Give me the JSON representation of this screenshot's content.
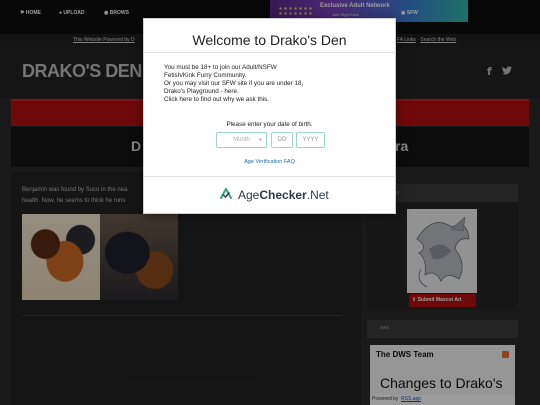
{
  "ad": {
    "title": "Exclusive Adult Network",
    "subtitle": "Join Right Now"
  },
  "powered_bar": {
    "left_text": "This Website Powered by D",
    "right_prefix": "FA Links",
    "right_sep": " · ",
    "right_link": "Search the Web"
  },
  "header": {
    "site_logo": "DRAKO'S DEN",
    "social_facebook_icon": "facebook-icon",
    "social_twitter_icon": "twitter-icon"
  },
  "nav": {
    "home": "HOME",
    "upload": "UPLOAD",
    "browse": "BROWS",
    "sfw": "SFW"
  },
  "page_title": {
    "left": "D",
    "right": "ra"
  },
  "content": {
    "story_line1": "Benjamin was found by Suco in the nea",
    "story_line2": "health. Now, he seems to think he runs"
  },
  "sidebar": {
    "mascot_panel_heading": "o",
    "submit_button": "Submit Mascot Art",
    "news_panel_heading": "ews",
    "news_card_title": "The DWS Team",
    "news_item": "Changes to Drako's",
    "powered_by": "Powered by",
    "rss_link": "RSS.app"
  },
  "modal": {
    "title": "Welcome to Drako's Den",
    "lines": [
      "You must be 18+ to join our Adult/NSFW",
      "Fetish/Kink Furry Community.",
      "Or you may visit our SFW site if you are under 18,",
      "Drako's Playground - here.",
      "Click here to find out why we ask this."
    ],
    "dob_prompt": "Please enter your date of birth.",
    "month_placeholder": "Month",
    "day_placeholder": "DD",
    "year_placeholder": "YYYY",
    "faq_link": "Age Verification FAQ",
    "brand_plain": "Age",
    "brand_bold": "Checker",
    "brand_suffix": ".Net"
  },
  "colors": {
    "nav_red": "#b40f0f",
    "modal_field_border": "#9fd6c9",
    "link_blue": "#1b6fa8"
  }
}
